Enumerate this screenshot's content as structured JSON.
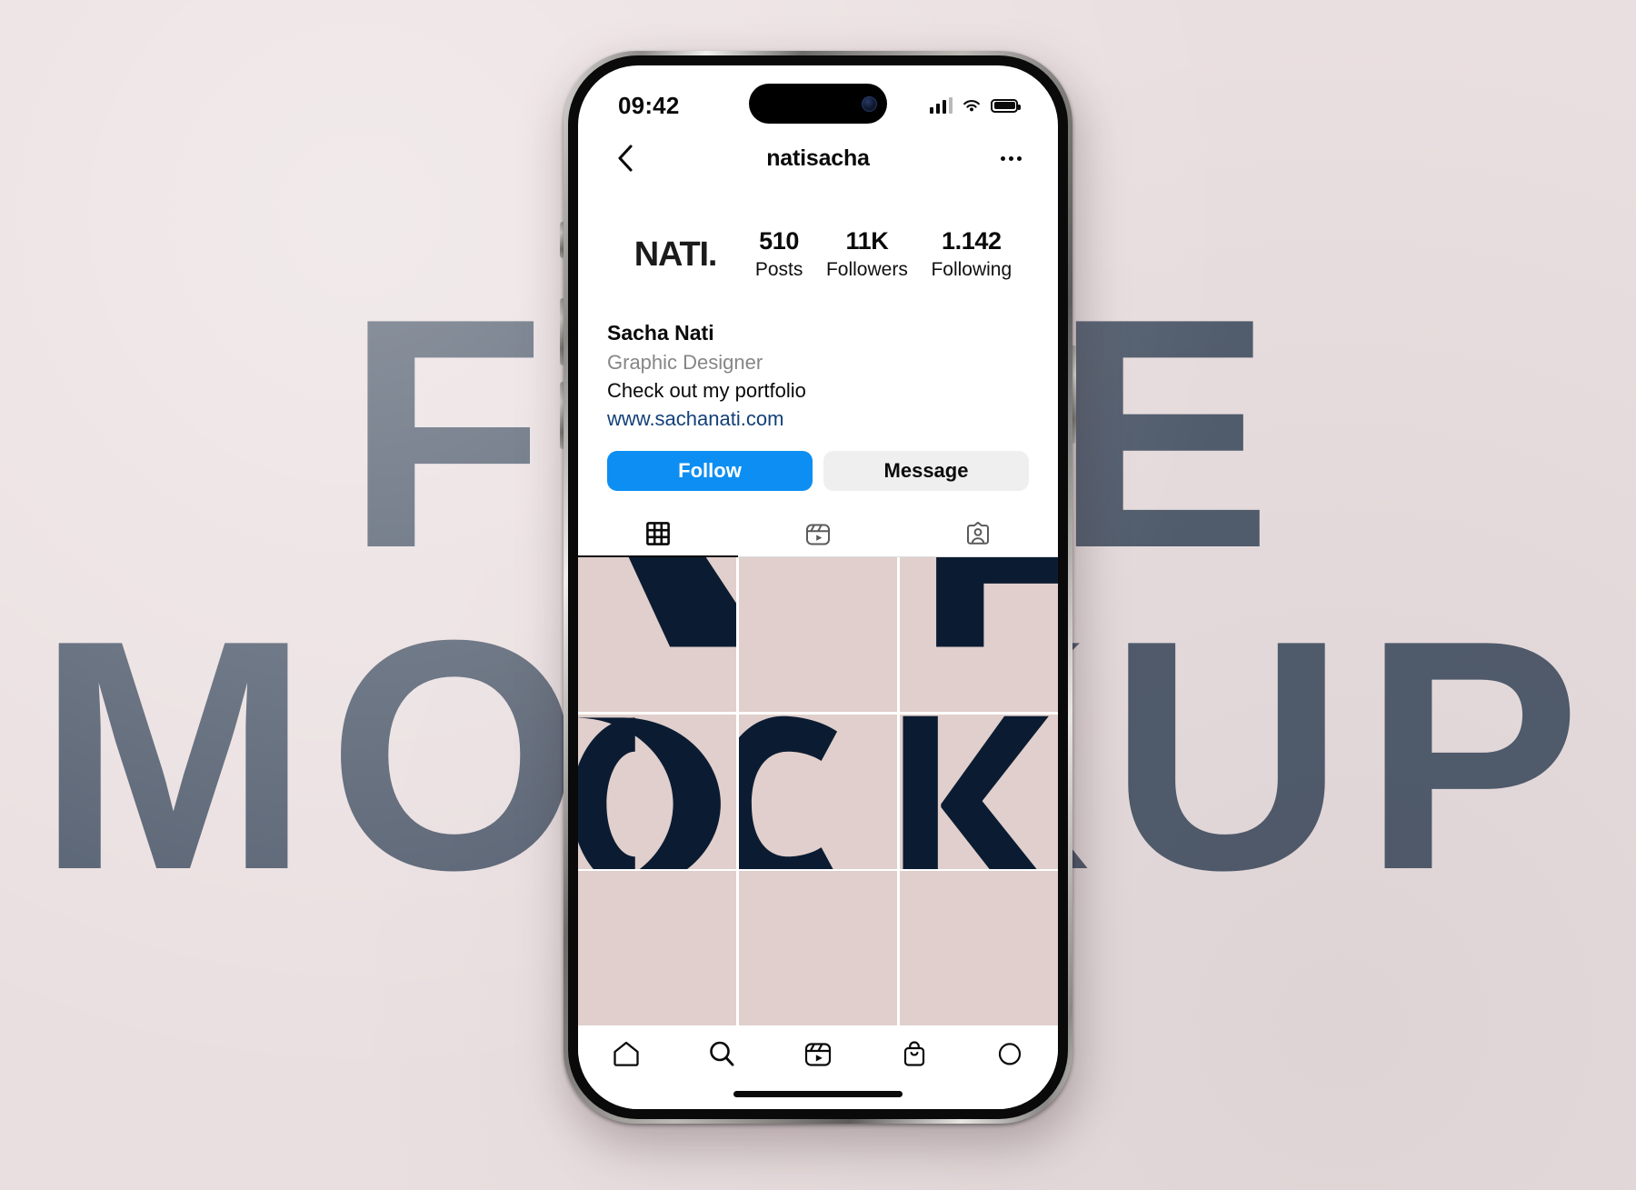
{
  "poster": {
    "line1": "FREE",
    "line2": "MOCKUP",
    "text_color": "#525d6e",
    "background_color": "#eadfe0"
  },
  "phone": {
    "status_bar": {
      "time": "09:42",
      "signal_icon": "cellular-bars-icon",
      "wifi_icon": "wifi-icon",
      "battery_icon": "battery-full-icon"
    },
    "home_indicator": "home-indicator"
  },
  "app": {
    "navbar": {
      "back_icon": "chevron-left-icon",
      "title": "natisacha",
      "more_icon": "ellipsis-icon"
    },
    "profile": {
      "avatar_logo": "NATI.",
      "stats": [
        {
          "value": "510",
          "label": "Posts"
        },
        {
          "value": "11K",
          "label": "Followers"
        },
        {
          "value": "1.142",
          "label": "Following"
        }
      ],
      "bio": {
        "name": "Sacha Nati",
        "category": "Graphic Designer",
        "description": "Check out my portfolio",
        "link": "www.sachanati.com",
        "link_color": "#12407a"
      },
      "actions": {
        "follow_label": "Follow",
        "follow_color": "#0d8ef2",
        "message_label": "Message",
        "message_color": "#efefef"
      },
      "tabs": [
        {
          "name": "grid-tab",
          "icon": "grid-icon",
          "active": true
        },
        {
          "name": "reels-tab",
          "icon": "reels-icon",
          "active": false
        },
        {
          "name": "tagged-tab",
          "icon": "tagged-person-icon",
          "active": false
        }
      ]
    },
    "grid": {
      "post_background": "#e0cfcc",
      "post_foreground": "#0b1c32",
      "posts": [
        {
          "name": "post-1",
          "glyph": "K-diagonal"
        },
        {
          "name": "post-2",
          "glyph": "blank"
        },
        {
          "name": "post-3",
          "glyph": "L-corner"
        },
        {
          "name": "post-4",
          "glyph": "O-left"
        },
        {
          "name": "post-5",
          "glyph": "C"
        },
        {
          "name": "post-6",
          "glyph": "K"
        },
        {
          "name": "post-7",
          "glyph": "blank"
        },
        {
          "name": "post-8",
          "glyph": "blank"
        },
        {
          "name": "post-9",
          "glyph": "blank"
        }
      ]
    },
    "tabbar": [
      {
        "name": "home-tab",
        "icon": "home-icon"
      },
      {
        "name": "search-tab",
        "icon": "search-icon"
      },
      {
        "name": "reels-tab",
        "icon": "reels-icon"
      },
      {
        "name": "shop-tab",
        "icon": "shopping-bag-icon"
      },
      {
        "name": "profile-tab",
        "icon": "profile-avatar-icon"
      }
    ]
  }
}
